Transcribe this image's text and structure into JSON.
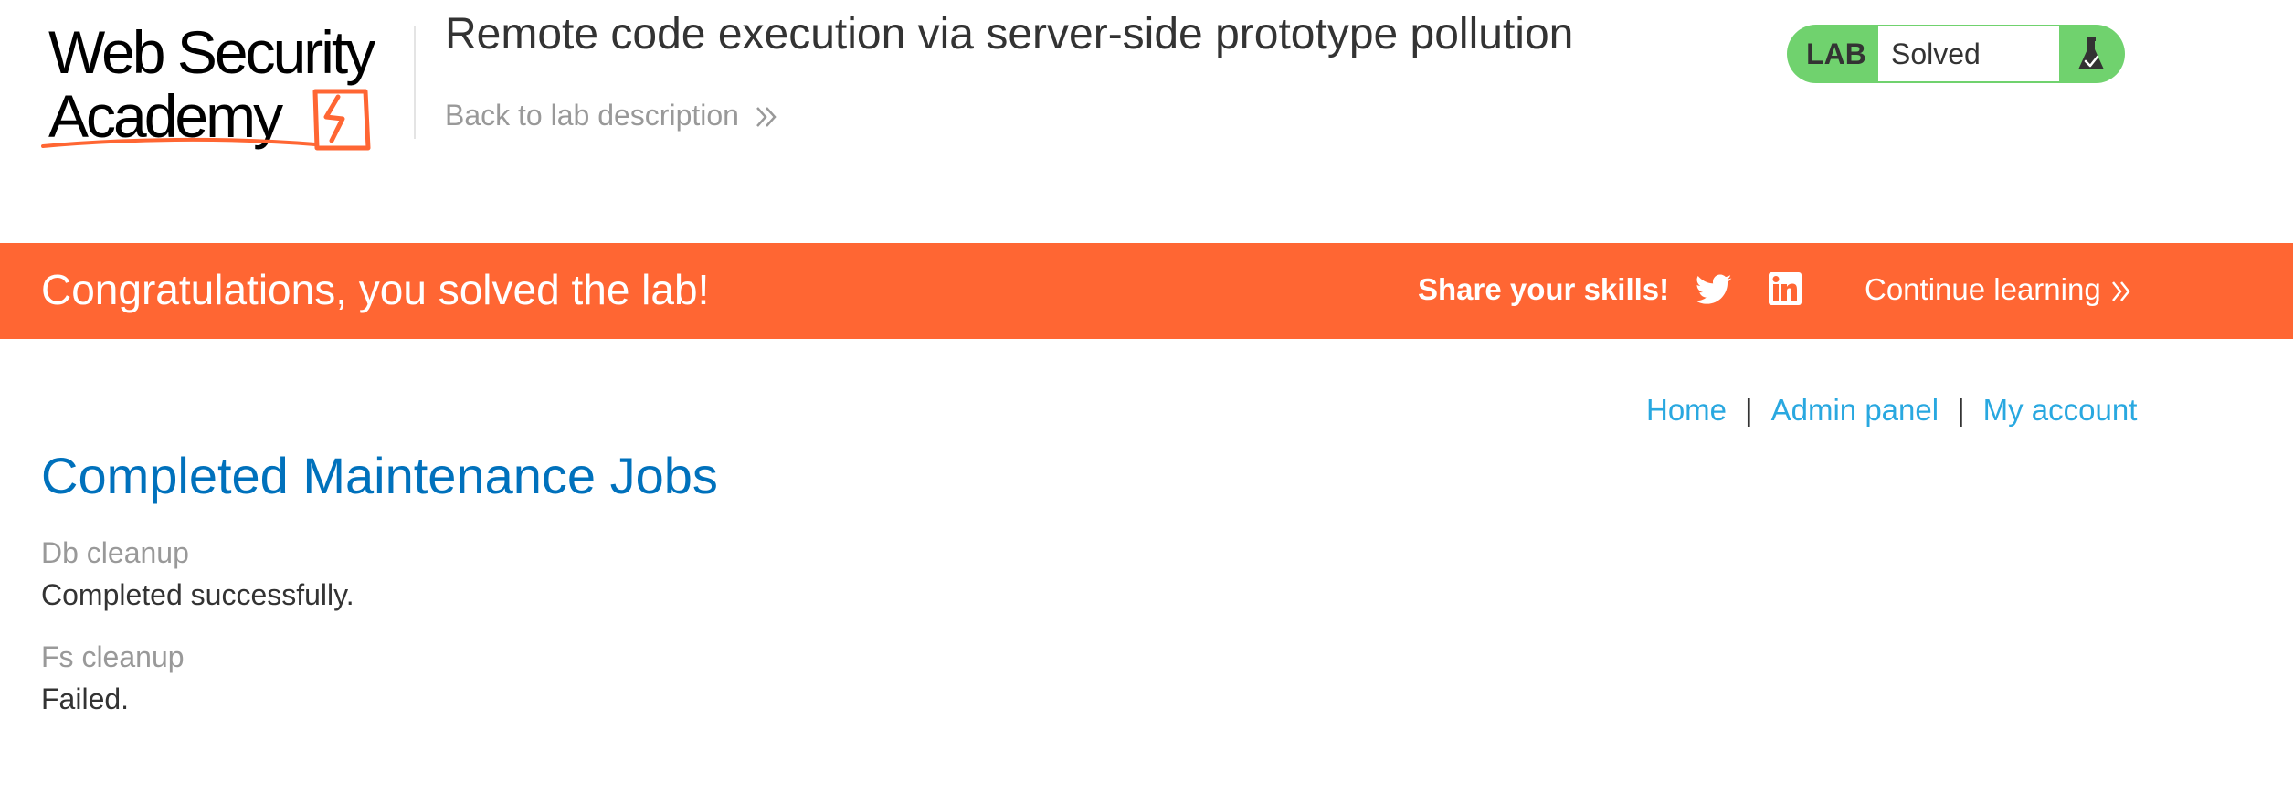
{
  "header": {
    "logo_text": "Web Security Academy",
    "lab_title": "Remote code execution via server-side prototype pollution",
    "back_link_label": "Back to lab description",
    "lab_status": {
      "label": "LAB",
      "state": "Solved",
      "icon": "flask-icon"
    }
  },
  "banner": {
    "message": "Congratulations, you solved the lab!",
    "share_label": "Share your skills!",
    "share_icons": [
      "twitter-icon",
      "linkedin-icon"
    ],
    "continue_label": "Continue learning"
  },
  "nav": {
    "items": [
      {
        "label": "Home"
      },
      {
        "label": "Admin panel"
      },
      {
        "label": "My account"
      }
    ],
    "separator": "|"
  },
  "main": {
    "title": "Completed Maintenance Jobs",
    "jobs": [
      {
        "name": "Db cleanup",
        "status": "Completed successfully."
      },
      {
        "name": "Fs cleanup",
        "status": "Failed."
      }
    ]
  },
  "colors": {
    "brand_orange": "#ff6633",
    "lab_solved_green": "#70d26e",
    "link_blue": "#29a8e0",
    "title_blue": "#0071bc"
  }
}
